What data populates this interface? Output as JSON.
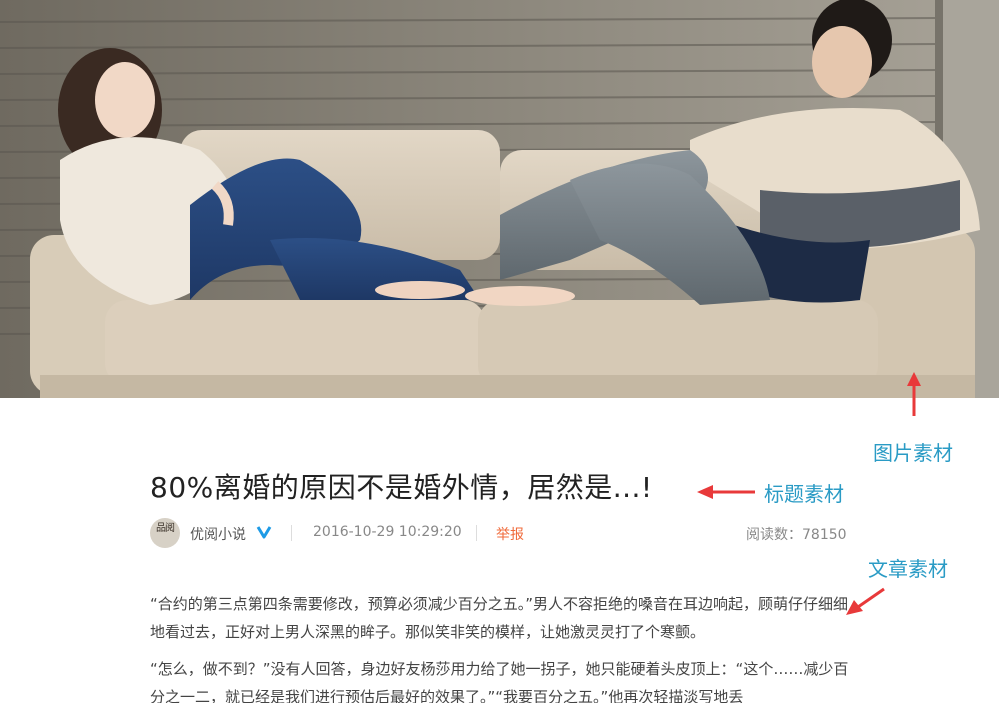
{
  "hero": {
    "image_description_icon": "photo-couple-on-sofa"
  },
  "article": {
    "title": "80%离婚的原因不是婚外情，居然是...!",
    "author": "优阅小说",
    "avatar_text": "品阅",
    "date": "2016-10-29 10:29:20",
    "report": "举报",
    "reads_label": "阅读数：",
    "reads_count": "78150",
    "paragraph1": "“合约的第三点第四条需要修改，预算必须减少百分之五。”男人不容拒绝的嗓音在耳边响起，顾萌仔仔细细地看过去，正好对上男人深黑的眸子。那似笑非笑的模样，让她激灵灵打了个寒颤。",
    "paragraph2": "“怎么，做不到？”没有人回答，身边好友杨莎用力给了她一拐子，她只能硬着头皮顶上：“这个……减少百分之一二，就已经是我们进行预估后最好的效果了。”“我要百分之五。”他再次轻描淡写地丢"
  },
  "annotations": {
    "image_label": "图片素材",
    "title_label": "标题素材",
    "text_label": "文章素材",
    "color": "#2a9bc5",
    "arrow_color": "#e8393a"
  }
}
